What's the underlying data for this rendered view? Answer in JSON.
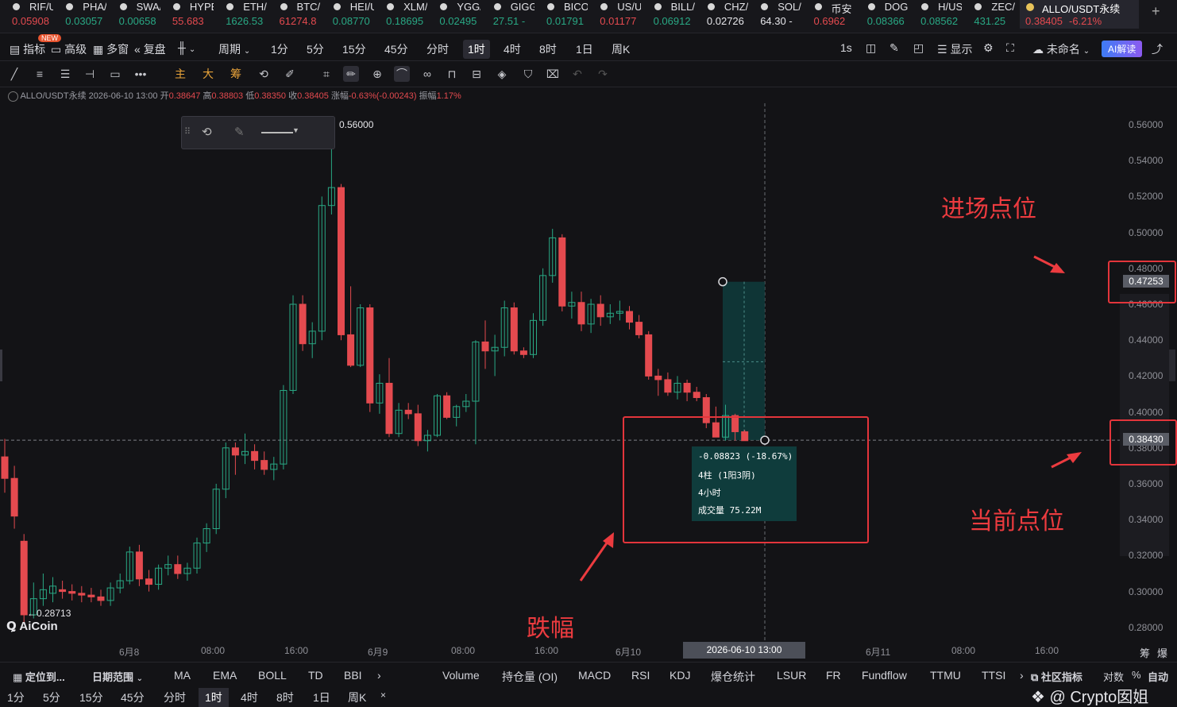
{
  "ticker": [
    {
      "name": "RIF/USDT",
      "price": "0.05908",
      "dir": "dn"
    },
    {
      "name": "PHA/USDT",
      "price": "0.03057",
      "dir": "up"
    },
    {
      "name": "SWA/USDT",
      "price": "0.00658",
      "dir": "up"
    },
    {
      "name": "HYPE/USDT",
      "price": "55.683",
      "dir": "dn"
    },
    {
      "name": "ETH/USDT",
      "price": "1626.53",
      "dir": "up"
    },
    {
      "name": "BTC/USDT",
      "price": "61274.8",
      "dir": "dn"
    },
    {
      "name": "HEI/USDT",
      "price": "0.08770",
      "dir": "up"
    },
    {
      "name": "XLM/USDT",
      "price": "0.18695",
      "dir": "up"
    },
    {
      "name": "YGG/USDT",
      "price": "0.02495",
      "dir": "up"
    },
    {
      "name": "GIGG",
      "price": "27.51 -",
      "dir": "up"
    },
    {
      "name": "BICO",
      "price": "0.01791",
      "dir": "up"
    },
    {
      "name": "US/USDT",
      "price": "0.01177",
      "dir": "dn"
    },
    {
      "name": "BILL/USDT",
      "price": "0.06912",
      "dir": "up"
    },
    {
      "name": "CHZ/USDT",
      "price": "0.02726",
      "dir": "wh"
    },
    {
      "name": "SOL/USDT",
      "price": "64.30 -",
      "dir": "wh"
    },
    {
      "name": "币安",
      "price": "0.6962",
      "dir": "dn"
    },
    {
      "name": "DOG",
      "price": "0.08366",
      "dir": "up"
    },
    {
      "name": "H/USDT",
      "price": "0.08562",
      "dir": "up"
    },
    {
      "name": "ZEC/USDT",
      "price": "431.25",
      "dir": "up"
    }
  ],
  "active_symbol": {
    "name": "ALLO/USDT永续",
    "price": "0.38405",
    "change": "-6.21%"
  },
  "menubar": {
    "indicators": "指标",
    "new_badge": "NEW",
    "advanced": "高级",
    "multi": "多窗",
    "replay": "复盘",
    "period": "周期",
    "timeframes": [
      "1分",
      "5分",
      "15分",
      "45分",
      "分时",
      "1时",
      "4时",
      "8时",
      "1日",
      "周K"
    ],
    "selected_tf": "1时",
    "interval": "1s",
    "display": "显示",
    "unnamed": "未命名",
    "ai": "AI解读"
  },
  "toolbar": {
    "main": "主",
    "big": "大",
    "chip": "筹"
  },
  "ohlc": {
    "symbol": "ALLO/USDT永续",
    "time": "2026-06-10 13:00",
    "open_label": "开",
    "open": "0.38647",
    "high_label": "高",
    "high": "0.38803",
    "low_label": "低",
    "low": "0.38350",
    "close_label": "收",
    "close": "0.38405",
    "chg_label": "涨幅",
    "chg": "-0.63%(-0.00243)",
    "amp_label": "振幅",
    "amp": "1.17%"
  },
  "chart_data": {
    "type": "candlestick",
    "ylim": [
      0.27,
      0.575
    ],
    "y_ticks": [
      "0.56000",
      "0.54000",
      "0.52000",
      "0.50000",
      "0.48000",
      "0.46000",
      "0.44000",
      "0.42000",
      "0.40000",
      "0.38000",
      "0.36000",
      "0.34000",
      "0.32000",
      "0.30000",
      "0.28000"
    ],
    "x_ticks": [
      "6月8",
      "08:00",
      "16:00",
      "6月9",
      "08:00",
      "16:00",
      "6月10",
      "6月11",
      "08:00",
      "16:00"
    ],
    "high_label": "0.56000",
    "low_label": "0.28713",
    "entry_price": "0.47253",
    "current_price": "0.38430",
    "measure": {
      "change": "-0.08823 (-18.67%)",
      "bars": "4柱 (1阳3阴)",
      "duration": "4小时",
      "volume": "成交量 75.22M"
    },
    "crosshair_time": "2026-06-10 13:00",
    "candles": [
      [
        0.375,
        0.385,
        0.355,
        0.363
      ],
      [
        0.363,
        0.37,
        0.335,
        0.342
      ],
      [
        0.328,
        0.332,
        0.283,
        0.287
      ],
      [
        0.287,
        0.305,
        0.285,
        0.296
      ],
      [
        0.296,
        0.31,
        0.292,
        0.301
      ],
      [
        0.299,
        0.308,
        0.294,
        0.303
      ],
      [
        0.301,
        0.306,
        0.296,
        0.3
      ],
      [
        0.3,
        0.304,
        0.295,
        0.299
      ],
      [
        0.299,
        0.303,
        0.294,
        0.298
      ],
      [
        0.298,
        0.302,
        0.294,
        0.297
      ],
      [
        0.297,
        0.301,
        0.292,
        0.295
      ],
      [
        0.295,
        0.305,
        0.292,
        0.302
      ],
      [
        0.302,
        0.31,
        0.299,
        0.306
      ],
      [
        0.306,
        0.325,
        0.304,
        0.322
      ],
      [
        0.322,
        0.326,
        0.303,
        0.307
      ],
      [
        0.307,
        0.312,
        0.3,
        0.304
      ],
      [
        0.304,
        0.315,
        0.301,
        0.313
      ],
      [
        0.313,
        0.32,
        0.309,
        0.315
      ],
      [
        0.315,
        0.32,
        0.307,
        0.31
      ],
      [
        0.31,
        0.316,
        0.306,
        0.313
      ],
      [
        0.313,
        0.33,
        0.31,
        0.327
      ],
      [
        0.327,
        0.338,
        0.322,
        0.335
      ],
      [
        0.335,
        0.36,
        0.332,
        0.357
      ],
      [
        0.357,
        0.383,
        0.352,
        0.38
      ],
      [
        0.38,
        0.383,
        0.365,
        0.376
      ],
      [
        0.376,
        0.388,
        0.371,
        0.378
      ],
      [
        0.378,
        0.382,
        0.368,
        0.373
      ],
      [
        0.373,
        0.378,
        0.365,
        0.368
      ],
      [
        0.368,
        0.375,
        0.362,
        0.371
      ],
      [
        0.371,
        0.415,
        0.368,
        0.412
      ],
      [
        0.412,
        0.465,
        0.41,
        0.46
      ],
      [
        0.46,
        0.465,
        0.434,
        0.438
      ],
      [
        0.438,
        0.45,
        0.43,
        0.445
      ],
      [
        0.445,
        0.52,
        0.44,
        0.515
      ],
      [
        0.515,
        0.547,
        0.51,
        0.525
      ],
      [
        0.525,
        0.527,
        0.44,
        0.443
      ],
      [
        0.443,
        0.47,
        0.425,
        0.426
      ],
      [
        0.426,
        0.46,
        0.425,
        0.458
      ],
      [
        0.458,
        0.46,
        0.4,
        0.405
      ],
      [
        0.405,
        0.421,
        0.399,
        0.416
      ],
      [
        0.416,
        0.43,
        0.386,
        0.388
      ],
      [
        0.388,
        0.405,
        0.386,
        0.401
      ],
      [
        0.401,
        0.405,
        0.396,
        0.399
      ],
      [
        0.399,
        0.404,
        0.381,
        0.384
      ],
      [
        0.384,
        0.39,
        0.378,
        0.387
      ],
      [
        0.387,
        0.41,
        0.386,
        0.409
      ],
      [
        0.409,
        0.411,
        0.396,
        0.397
      ],
      [
        0.397,
        0.404,
        0.392,
        0.403
      ],
      [
        0.403,
        0.41,
        0.4,
        0.406
      ],
      [
        0.406,
        0.44,
        0.382,
        0.439
      ],
      [
        0.439,
        0.451,
        0.424,
        0.434
      ],
      [
        0.434,
        0.443,
        0.42,
        0.436
      ],
      [
        0.436,
        0.462,
        0.431,
        0.458
      ],
      [
        0.458,
        0.461,
        0.432,
        0.434
      ],
      [
        0.434,
        0.436,
        0.43,
        0.432
      ],
      [
        0.432,
        0.455,
        0.43,
        0.451
      ],
      [
        0.451,
        0.48,
        0.448,
        0.476
      ],
      [
        0.476,
        0.502,
        0.472,
        0.497
      ],
      [
        0.497,
        0.499,
        0.456,
        0.459
      ],
      [
        0.459,
        0.467,
        0.452,
        0.461
      ],
      [
        0.461,
        0.467,
        0.445,
        0.449
      ],
      [
        0.449,
        0.463,
        0.444,
        0.46
      ],
      [
        0.46,
        0.465,
        0.448,
        0.453
      ],
      [
        0.453,
        0.46,
        0.449,
        0.455
      ],
      [
        0.455,
        0.462,
        0.451,
        0.456
      ],
      [
        0.456,
        0.459,
        0.446,
        0.45
      ],
      [
        0.45,
        0.454,
        0.441,
        0.443
      ],
      [
        0.443,
        0.445,
        0.418,
        0.42
      ],
      [
        0.42,
        0.424,
        0.409,
        0.418
      ],
      [
        0.418,
        0.422,
        0.409,
        0.411
      ],
      [
        0.411,
        0.42,
        0.407,
        0.416
      ],
      [
        0.416,
        0.418,
        0.406,
        0.411
      ],
      [
        0.411,
        0.414,
        0.406,
        0.408
      ],
      [
        0.408,
        0.41,
        0.391,
        0.394
      ],
      [
        0.394,
        0.403,
        0.386,
        0.386
      ],
      [
        0.386,
        0.404,
        0.384,
        0.398
      ],
      [
        0.398,
        0.399,
        0.384,
        0.389
      ],
      [
        0.389,
        0.39,
        0.384,
        0.384
      ]
    ]
  },
  "annotations": {
    "entry": "进场点位",
    "current": "当前点位",
    "drop": "跌幅"
  },
  "watermark": "AiCoin",
  "bottombar": {
    "locate": "定位到...",
    "date_range": "日期范围",
    "indicators": [
      "MA",
      "EMA",
      "BOLL",
      "TD",
      "BBI"
    ],
    "sub_indicators": [
      "Volume",
      "持仓量 (OI)",
      "MACD",
      "RSI",
      "KDJ",
      "爆仓统计",
      "LSUR",
      "FR",
      "Fundflow",
      "TTMU",
      "TTSI"
    ],
    "community": "社区指标",
    "log": "对数",
    "pct": "%",
    "auto": "自动",
    "chip": "筹",
    "burst": "爆"
  },
  "tfbar": {
    "items": [
      "1分",
      "5分",
      "15分",
      "45分",
      "分时",
      "1时",
      "4时",
      "8时",
      "1日",
      "周K"
    ],
    "selected": "1时",
    "credit": "@ Crypto囡姐"
  },
  "colors": {
    "up": "#29a884",
    "down": "#e44a4f",
    "bg": "#131316",
    "measure": "#0f3c3c",
    "annot": "#ec3b3f"
  }
}
